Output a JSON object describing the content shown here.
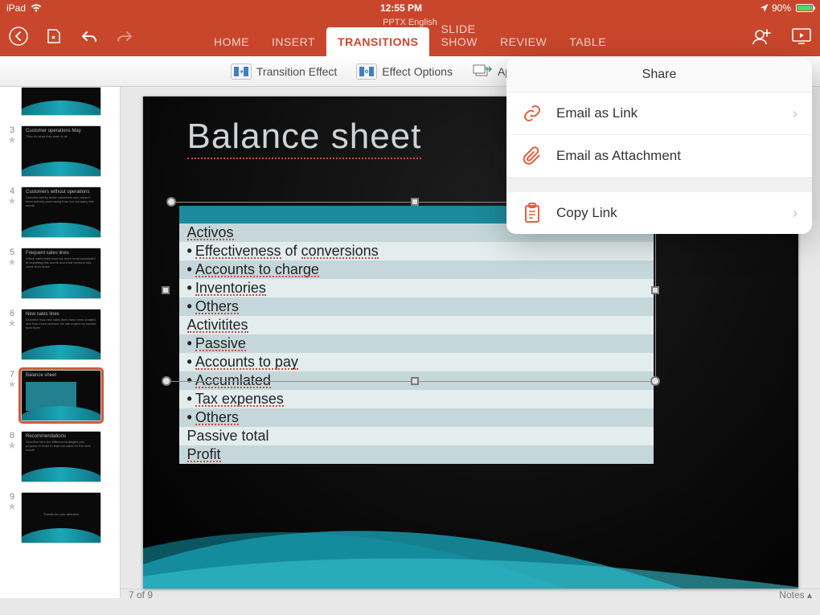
{
  "status": {
    "device": "iPad",
    "time": "12:55 PM",
    "battery": "90%"
  },
  "doc_title": "PPTX English",
  "tabs": {
    "home": "HOME",
    "insert": "INSERT",
    "transitions": "TRANSITIONS",
    "slideshow": "SLIDE SHOW",
    "review": "REVIEW",
    "table": "TABLE"
  },
  "toolbar": {
    "transition_effect": "Transition Effect",
    "effect_options": "Effect Options",
    "apply_all": "Apply To All Slides"
  },
  "popover": {
    "title": "Share",
    "email_link": "Email as Link",
    "email_attachment": "Email as Attachment",
    "copy_link": "Copy Link"
  },
  "thumbs": [
    {
      "num": "",
      "title": "",
      "sub": ""
    },
    {
      "num": "3",
      "title": "Customer operations May",
      "sub": "They do what they want to do"
    },
    {
      "num": "4",
      "title": "Customers without operations",
      "sub": "Describe briefly those customers who haven't been actively purchasing from our company this month"
    },
    {
      "num": "5",
      "title": "Frequent sales lines",
      "sub": "Which sales lines have we been most successful at exploiting this month and what revenue has come from those"
    },
    {
      "num": "6",
      "title": "New sales lines",
      "sub": "Describe how new sales lines have been created and how much revenue we can expect as income from them"
    },
    {
      "num": "7",
      "title": "Balance sheet",
      "sub": ""
    },
    {
      "num": "8",
      "title": "Recommendations",
      "sub": "Describe here the different strategies you propose in order to improve sales for the next month"
    },
    {
      "num": "9",
      "title": "",
      "sub": "Thanks for your attention"
    }
  ],
  "slide": {
    "title": "Balance sheet",
    "rows": [
      "Activos",
      "Effectiveness of conversions",
      "Accounts to charge",
      "Inventories",
      "Others",
      "Activitites",
      "Passive",
      "Accounts to pay",
      "Accumlated",
      "Tax expenses",
      "Others",
      "Passive total",
      "Profit"
    ]
  },
  "footer": {
    "page": "7 of 9",
    "notes": "Notes"
  }
}
